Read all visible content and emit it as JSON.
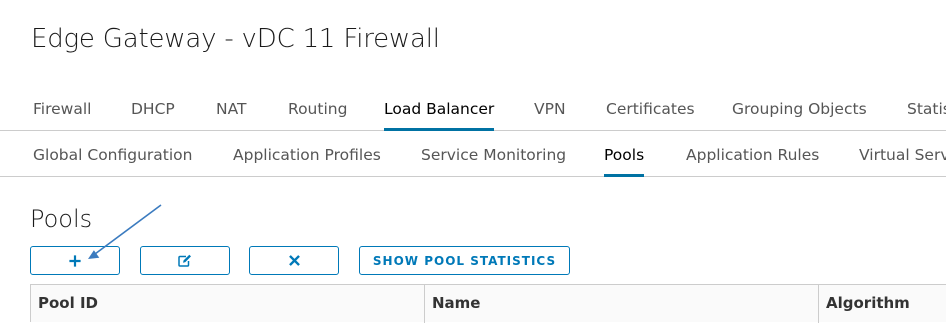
{
  "page": {
    "title": "Edge Gateway - vDC 11 Firewall"
  },
  "primary_tabs": [
    {
      "label": "Firewall",
      "active": false
    },
    {
      "label": "DHCP",
      "active": false
    },
    {
      "label": "NAT",
      "active": false
    },
    {
      "label": "Routing",
      "active": false
    },
    {
      "label": "Load Balancer",
      "active": true
    },
    {
      "label": "VPN",
      "active": false
    },
    {
      "label": "Certificates",
      "active": false
    },
    {
      "label": "Grouping Objects",
      "active": false
    },
    {
      "label": "Statis",
      "active": false
    }
  ],
  "secondary_tabs": [
    {
      "label": "Global Configuration",
      "active": false
    },
    {
      "label": "Application Profiles",
      "active": false
    },
    {
      "label": "Service Monitoring",
      "active": false
    },
    {
      "label": "Pools",
      "active": true
    },
    {
      "label": "Application Rules",
      "active": false
    },
    {
      "label": "Virtual Serv",
      "active": false
    }
  ],
  "pools": {
    "title": "Pools",
    "toolbar": {
      "add_icon": "plus-icon",
      "edit_icon": "edit-icon",
      "delete_icon": "close-icon",
      "stats_label": "SHOW POOL STATISTICS"
    },
    "columns": [
      "Pool ID",
      "Name",
      "Algorithm"
    ]
  },
  "colors": {
    "accent": "#0079b8",
    "active_tab_underline": "#0072a3",
    "annotation_arrow": "#3b7bbf"
  }
}
